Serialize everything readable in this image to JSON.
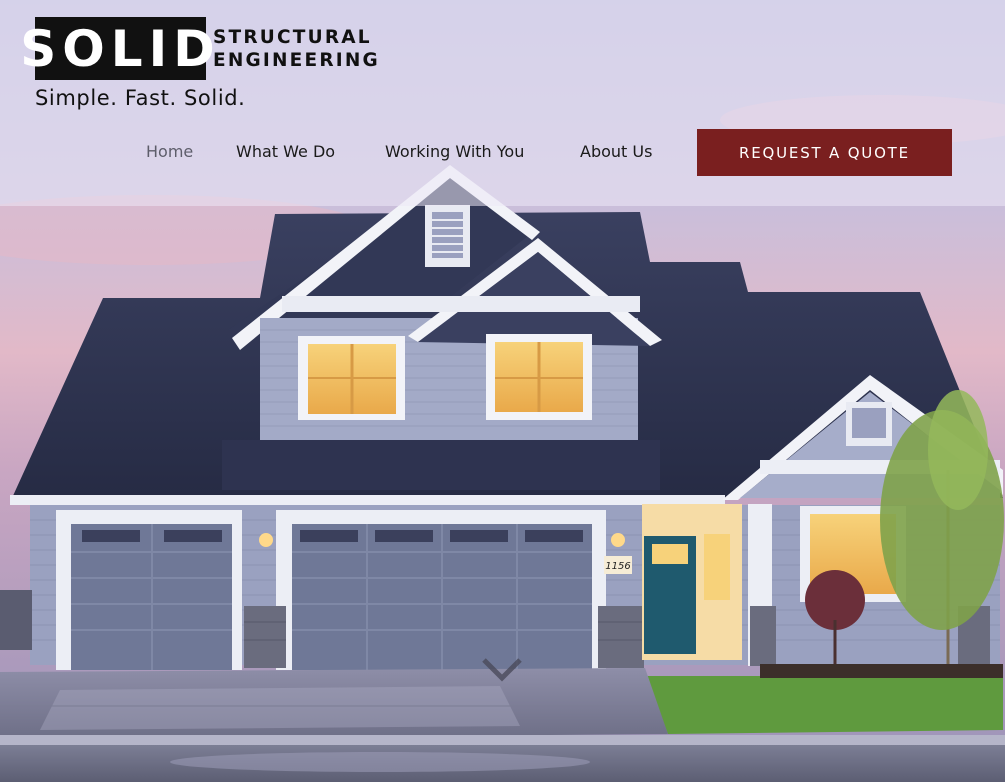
{
  "logo": {
    "word": "SOLID",
    "sub_line1": "STRUCTURAL",
    "sub_line2": "ENGINEERING"
  },
  "tagline": "Simple. Fast. Solid.",
  "nav": {
    "items": [
      {
        "label": "Home",
        "active": true
      },
      {
        "label": "What We Do",
        "active": false
      },
      {
        "label": "Working With You",
        "active": false
      },
      {
        "label": "About Us",
        "active": false
      }
    ],
    "cta_label": "REQUEST A QUOTE"
  },
  "hero": {
    "house_number": "1156"
  },
  "colors": {
    "cta": "#7a1f1f",
    "roof": "#2f3552",
    "siding": "#8b93b4",
    "trim": "#eef0f6",
    "window_light": "#f5c85a"
  },
  "icons": {
    "scroll": "chevron-down-icon"
  }
}
